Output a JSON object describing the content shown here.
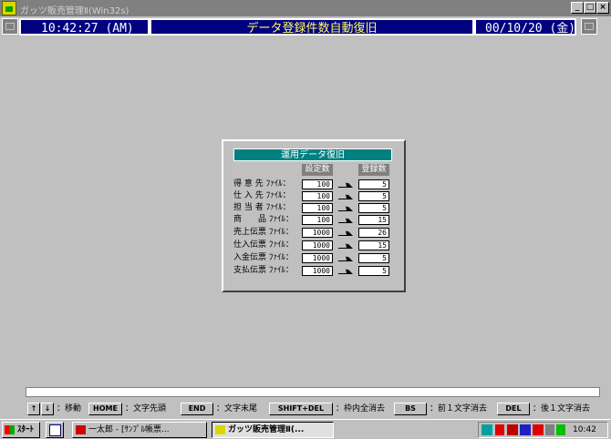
{
  "window": {
    "title": "ガッツ販売管理Ⅱ(Win32s)",
    "controls": [
      "_",
      "□",
      "×"
    ]
  },
  "header": {
    "time": "10:42:27 (AM)",
    "screen_title": "データ登録件数自動復旧",
    "date": "00/10/20 (金)"
  },
  "dialog": {
    "title": "運用データ復旧",
    "col_setting": "設定数",
    "col_registered": "登録数",
    "rows": [
      {
        "label": "得 意 先 ﾌｧｲﾙ：",
        "setting": "100",
        "registered": "5"
      },
      {
        "label": "仕 入 先 ﾌｧｲﾙ：",
        "setting": "100",
        "registered": "5"
      },
      {
        "label": "担 当 者 ﾌｧｲﾙ：",
        "setting": "100",
        "registered": "5"
      },
      {
        "label": "商　　品 ﾌｧｲﾙ：",
        "setting": "100",
        "registered": "15"
      },
      {
        "label": "売上伝票 ﾌｧｲﾙ：",
        "setting": "1000",
        "registered": "26"
      },
      {
        "label": "仕入伝票 ﾌｧｲﾙ：",
        "setting": "1000",
        "registered": "15"
      },
      {
        "label": "入金伝票 ﾌｧｲﾙ：",
        "setting": "1000",
        "registered": "5"
      },
      {
        "label": "支払伝票 ﾌｧｲﾙ：",
        "setting": "1000",
        "registered": "5"
      }
    ]
  },
  "keyhelp": {
    "up": "↑",
    "down": "↓",
    "move": "：移動",
    "home": "HOME",
    "home_desc": "：文字先頭",
    "end": "END",
    "end_desc": "：文字末尾",
    "shiftdel": "SHIFT+DEL",
    "shiftdel_desc": "：枠内全消去",
    "bs": "BS",
    "bs_desc": "：前１文字消去",
    "del": "DEL",
    "del_desc": "：後１文字消去"
  },
  "taskbar": {
    "start": "ｽﾀｰﾄ",
    "task1": "一太郎 - [ｻﾝﾌﾟﾙ帳票...",
    "task2": "ガッツ販売管理Ⅱ(...",
    "clock": "10:42"
  }
}
